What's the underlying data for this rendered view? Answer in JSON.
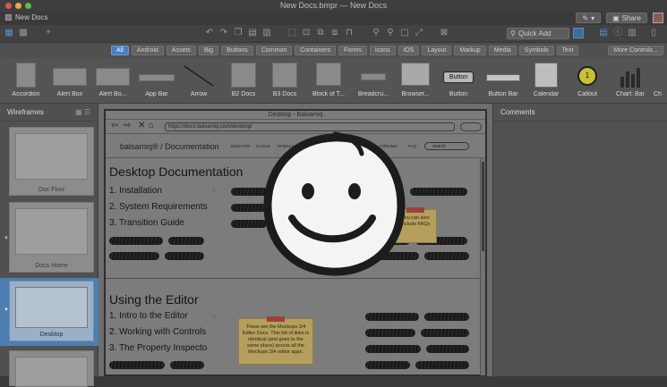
{
  "window": {
    "title": "New Docs.bmpr — New Docs",
    "traffic_colors": [
      "#e0534c",
      "#e1b13c",
      "#56c24a"
    ]
  },
  "tabrow": {
    "doc_tab": "New Docs",
    "share_label": "Share"
  },
  "toolbar": {
    "quick_add_placeholder": "Quick Add"
  },
  "filters": {
    "items": [
      "All",
      "Android",
      "Assets",
      "Big",
      "Buttons",
      "Common",
      "Containers",
      "Forms",
      "Icons",
      "iOS",
      "Layout",
      "Markup",
      "Media",
      "Symbols",
      "Text"
    ],
    "active": "All",
    "more_label": "More Controls..."
  },
  "library": {
    "items": [
      "Accordion",
      "Alert Box",
      "Alert Bo...",
      "App Bar",
      "Arrow",
      "B2 Docs",
      "B3 Docs",
      "Block of T...",
      "Breadcru...",
      "Browser...",
      "Button",
      "Button Bar",
      "Calendar",
      "Callout",
      "Chart: Bar",
      "Ch"
    ]
  },
  "wireframes": {
    "title": "Wireframes",
    "pages": [
      "Doc Flow",
      "Docs Home",
      "Desktop"
    ]
  },
  "canvas": {
    "browser_title": "Desktop - Balsamiq",
    "url": "https://docs.balsamiq.com/desktop/",
    "brand": "balsamiq® / Documentation",
    "nav_items": [
      "DESKTOP",
      "CLOUD",
      "MYBALSAMIQ",
      "WIREFRAMES",
      "GOOGLE DRIVE",
      "CONFLUENCE",
      "JIRA",
      "GUIDE",
      "MIGRATION",
      "NEWS",
      "SUPPORT",
      "FORUMS",
      "FAQ"
    ],
    "search_placeholder": "search",
    "section1": {
      "title": "Desktop Documentation",
      "items": [
        "1. Installation",
        "2. System Requirements",
        "3. Transition Guide"
      ],
      "sticky": "You can also include FAQs"
    },
    "section2": {
      "title": "Using the Editor",
      "items": [
        "1. Intro to the Editor",
        "2. Working with Controls",
        "3. The Property Inspecto"
      ],
      "sticky": "These are the Mockups 3/4 Editor Docs. This list of links is identical (and goes to the same place) across all the Mockups 3/4 editor apps."
    }
  },
  "comments": {
    "title": "Comments"
  },
  "icons": {
    "logo": "balsamiq-smiley-logo",
    "quick_add": "search-icon"
  }
}
